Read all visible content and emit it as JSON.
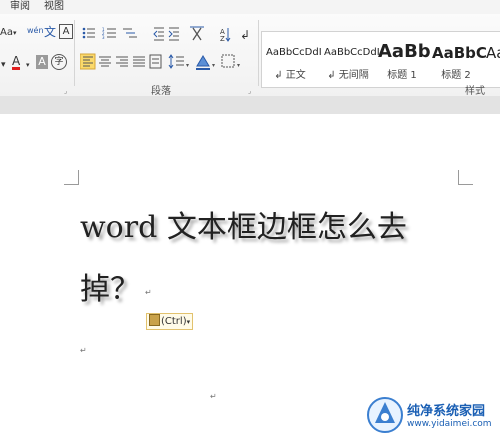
{
  "menu": {
    "review": "审阅",
    "view": "视图"
  },
  "ribbon": {
    "paragraph_label": "段落",
    "styles_label": "样式",
    "styles": [
      {
        "preview": "AaBbCcDdI",
        "name": "↲ 正文"
      },
      {
        "preview": "AaBbCcDdI",
        "name": "↲ 无间隔"
      },
      {
        "preview": "AaBb",
        "name": "标题 1"
      },
      {
        "preview": "AaBbC",
        "name": "标题 2"
      },
      {
        "preview": "Aa",
        "name": ""
      }
    ],
    "font_size_btn": "Aa",
    "font_color_btn": "A",
    "char_shade_btn": "A",
    "char_border_btn": "A",
    "enclose_btn": "字",
    "phonetic_btn": "文",
    "sort_btn": "A↓Z"
  },
  "document": {
    "title_line1": "word 文本框边框怎么去",
    "title_line2": "掉？",
    "paste_options": "(Ctrl)",
    "para_mark": "↵"
  },
  "watermark": {
    "title": "纯净系统家园",
    "url": "www.yidaimei.com"
  },
  "colors": {
    "accent_highlight": "#fbd96a",
    "font_red": "#e02020"
  }
}
